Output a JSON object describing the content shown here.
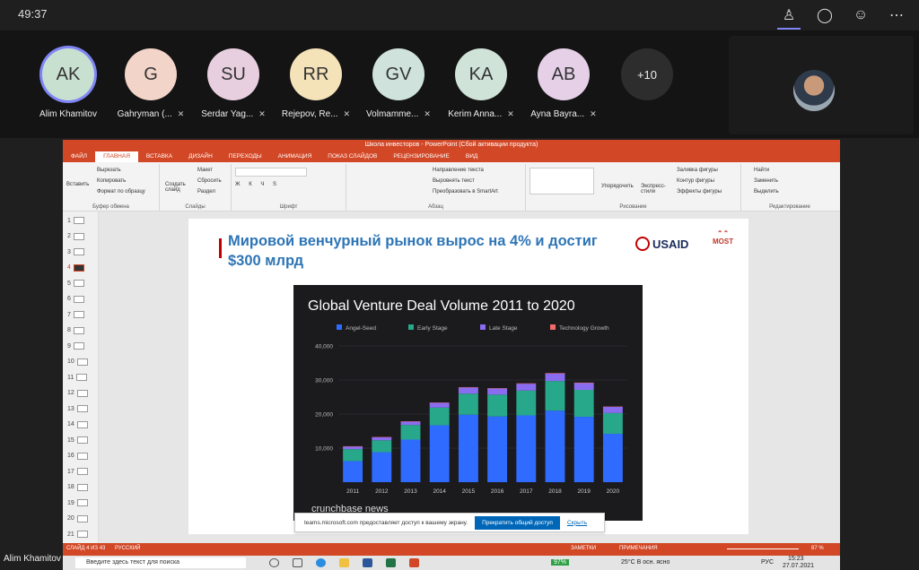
{
  "call": {
    "timer": "49:37",
    "participants": [
      {
        "initials": "AK",
        "name": "Alim Khamitov",
        "color": "#c8e0d0",
        "muted": false,
        "active": true
      },
      {
        "initials": "G",
        "name": "Gahryman (...",
        "color": "#f2d4c8",
        "muted": true,
        "active": false
      },
      {
        "initials": "SU",
        "name": "Serdar Yag...",
        "color": "#e8cfe0",
        "muted": true,
        "active": false
      },
      {
        "initials": "RR",
        "name": "Rejepov, Re...",
        "color": "#f4e2b8",
        "muted": true,
        "active": false
      },
      {
        "initials": "GV",
        "name": "Volmamme...",
        "color": "#cfe3dc",
        "muted": true,
        "active": false
      },
      {
        "initials": "KA",
        "name": "Kerim Anna...",
        "color": "#cfe3d8",
        "muted": true,
        "active": false
      },
      {
        "initials": "AB",
        "name": "Ayna Bayra...",
        "color": "#e6d0e8",
        "muted": true,
        "active": false
      }
    ],
    "more_count": "+10",
    "presenter_name": "Alim Khamitov"
  },
  "ppt": {
    "window_title": "Школа инвесторов - PowerPoint (Сбой активации продукта)",
    "tabs": [
      "ФАЙЛ",
      "ГЛАВНАЯ",
      "ВСТАВКА",
      "ДИЗАЙН",
      "ПЕРЕХОДЫ",
      "АНИМАЦИЯ",
      "ПОКАЗ СЛАЙДОВ",
      "РЕЦЕНЗИРОВАНИЕ",
      "ВИД"
    ],
    "ribbon": {
      "clipboard": {
        "paste": "Вставить",
        "cut": "Вырезать",
        "copy": "Копировать",
        "format": "Формат по образцу",
        "group": "Буфер обмена"
      },
      "slides": {
        "new": "Создать слайд",
        "layout": "Макет",
        "reset": "Сбросить",
        "section": "Раздел",
        "group": "Слайды"
      },
      "font": {
        "group": "Шрифт"
      },
      "paragraph": {
        "dir": "Направление текста",
        "align": "Выровнять текст",
        "smartart": "Преобразовать в SmartArt",
        "group": "Абзац"
      },
      "drawing": {
        "arrange": "Упорядочить",
        "styles": "Экспресс-стили",
        "fill": "Заливка фигуры",
        "outline": "Контур фигуры",
        "effects": "Эффекты фигуры",
        "group": "Рисование"
      },
      "editing": {
        "find": "Найти",
        "replace": "Заменить",
        "select": "Выделить",
        "group": "Редактирование"
      }
    },
    "thumbs": [
      "1",
      "2",
      "3",
      "4",
      "5",
      "6",
      "7",
      "8",
      "9",
      "10",
      "11",
      "12",
      "13",
      "14",
      "15",
      "16",
      "17",
      "18",
      "19",
      "20",
      "21"
    ],
    "current_slide": "4",
    "status": {
      "slide": "СЛАЙД 4 ИЗ 43",
      "lang": "РУССКИЙ",
      "notes": "ЗАМЕТКИ",
      "comments": "ПРИМЕЧАНИЯ",
      "zoom": "87 %"
    }
  },
  "slide": {
    "title": "Мировой венчурный рынок вырос на 4% и достиг $300 млрд",
    "usaid": "USAID",
    "most": "MOST"
  },
  "chart_data": {
    "type": "bar",
    "title": "Global Venture Deal Volume 2011 to 2020",
    "categories": [
      "2011",
      "2012",
      "2013",
      "2014",
      "2015",
      "2016",
      "2017",
      "2018",
      "2019",
      "2020"
    ],
    "stacked": true,
    "series": [
      {
        "name": "Angel-Seed",
        "color": "#2f6bff",
        "values": [
          6200,
          8800,
          12500,
          16700,
          19800,
          19300,
          19600,
          21000,
          19200,
          14200
        ]
      },
      {
        "name": "Early Stage",
        "color": "#27a88a",
        "values": [
          3500,
          3500,
          4300,
          5200,
          6200,
          6400,
          7300,
          8700,
          7900,
          6100
        ]
      },
      {
        "name": "Late Stage",
        "color": "#8a6cf0",
        "values": [
          800,
          900,
          1000,
          1400,
          1800,
          1800,
          2000,
          2200,
          2000,
          1800
        ]
      },
      {
        "name": "Technology Growth",
        "color": "#f26b6b",
        "values": [
          50,
          50,
          60,
          80,
          100,
          100,
          120,
          150,
          140,
          100
        ]
      }
    ],
    "yticks": [
      "40,000",
      "30,000",
      "20,000",
      "10,000"
    ],
    "ylim": [
      0,
      40000
    ],
    "source": "crunchbase news"
  },
  "banner": {
    "text": "teams.microsoft.com предоставляет доступ к вашему экрану.",
    "stop": "Прекратить общий доступ",
    "hide": "Скрыть"
  },
  "taskbar": {
    "search": "Введите здесь текст для поиска",
    "battery": "97%",
    "weather": "25°C В осн. ясно",
    "lang": "РУС",
    "time": "15:23",
    "date": "27.07.2021"
  }
}
